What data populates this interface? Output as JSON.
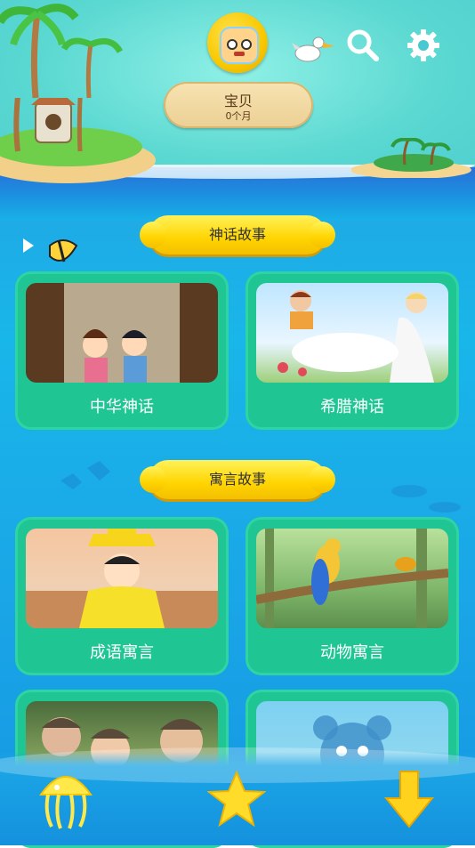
{
  "header": {
    "baby_name": "宝贝",
    "baby_age": "0个月",
    "icons": {
      "avatar": "robot-avatar-icon",
      "bird": "pelican-icon",
      "search": "search-icon",
      "settings": "gear-icon"
    }
  },
  "sections": [
    {
      "title": "神话故事",
      "cards": [
        {
          "label": "中华神话"
        },
        {
          "label": "希腊神话"
        }
      ]
    },
    {
      "title": "寓言故事",
      "cards": [
        {
          "label": "成语寓言"
        },
        {
          "label": "动物寓言"
        }
      ]
    }
  ],
  "bottom_nav": {
    "items": [
      "jellyfish-icon",
      "star-icon",
      "download-arrow-icon"
    ]
  },
  "colors": {
    "card": "#1fc693",
    "pill": "#ffd400",
    "sea": "#1aa6e7"
  }
}
